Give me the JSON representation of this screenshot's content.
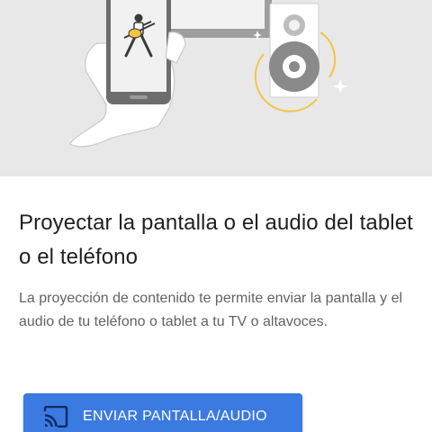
{
  "illustration": {
    "subject": "hand holding phone showing guitarist, casting to speaker",
    "icons": [
      "hand",
      "phone",
      "guitarist",
      "tv",
      "speaker",
      "sparkle"
    ],
    "colors": {
      "background": "#e8e8e8",
      "accent_ring": "#f4c542",
      "device": "#6d6d6d"
    }
  },
  "title": "Proyectar la pantalla o el audio del tablet o el teléfono",
  "description": "La proyección de contenido te permite enviar la pantalla y el audio de tu teléfono o tablet a tu TV o altavoces.",
  "cast_button": {
    "label": "ENVIAR PANTALLA/AUDIO",
    "icon": "cast-icon",
    "color": "#3b7ae0"
  }
}
